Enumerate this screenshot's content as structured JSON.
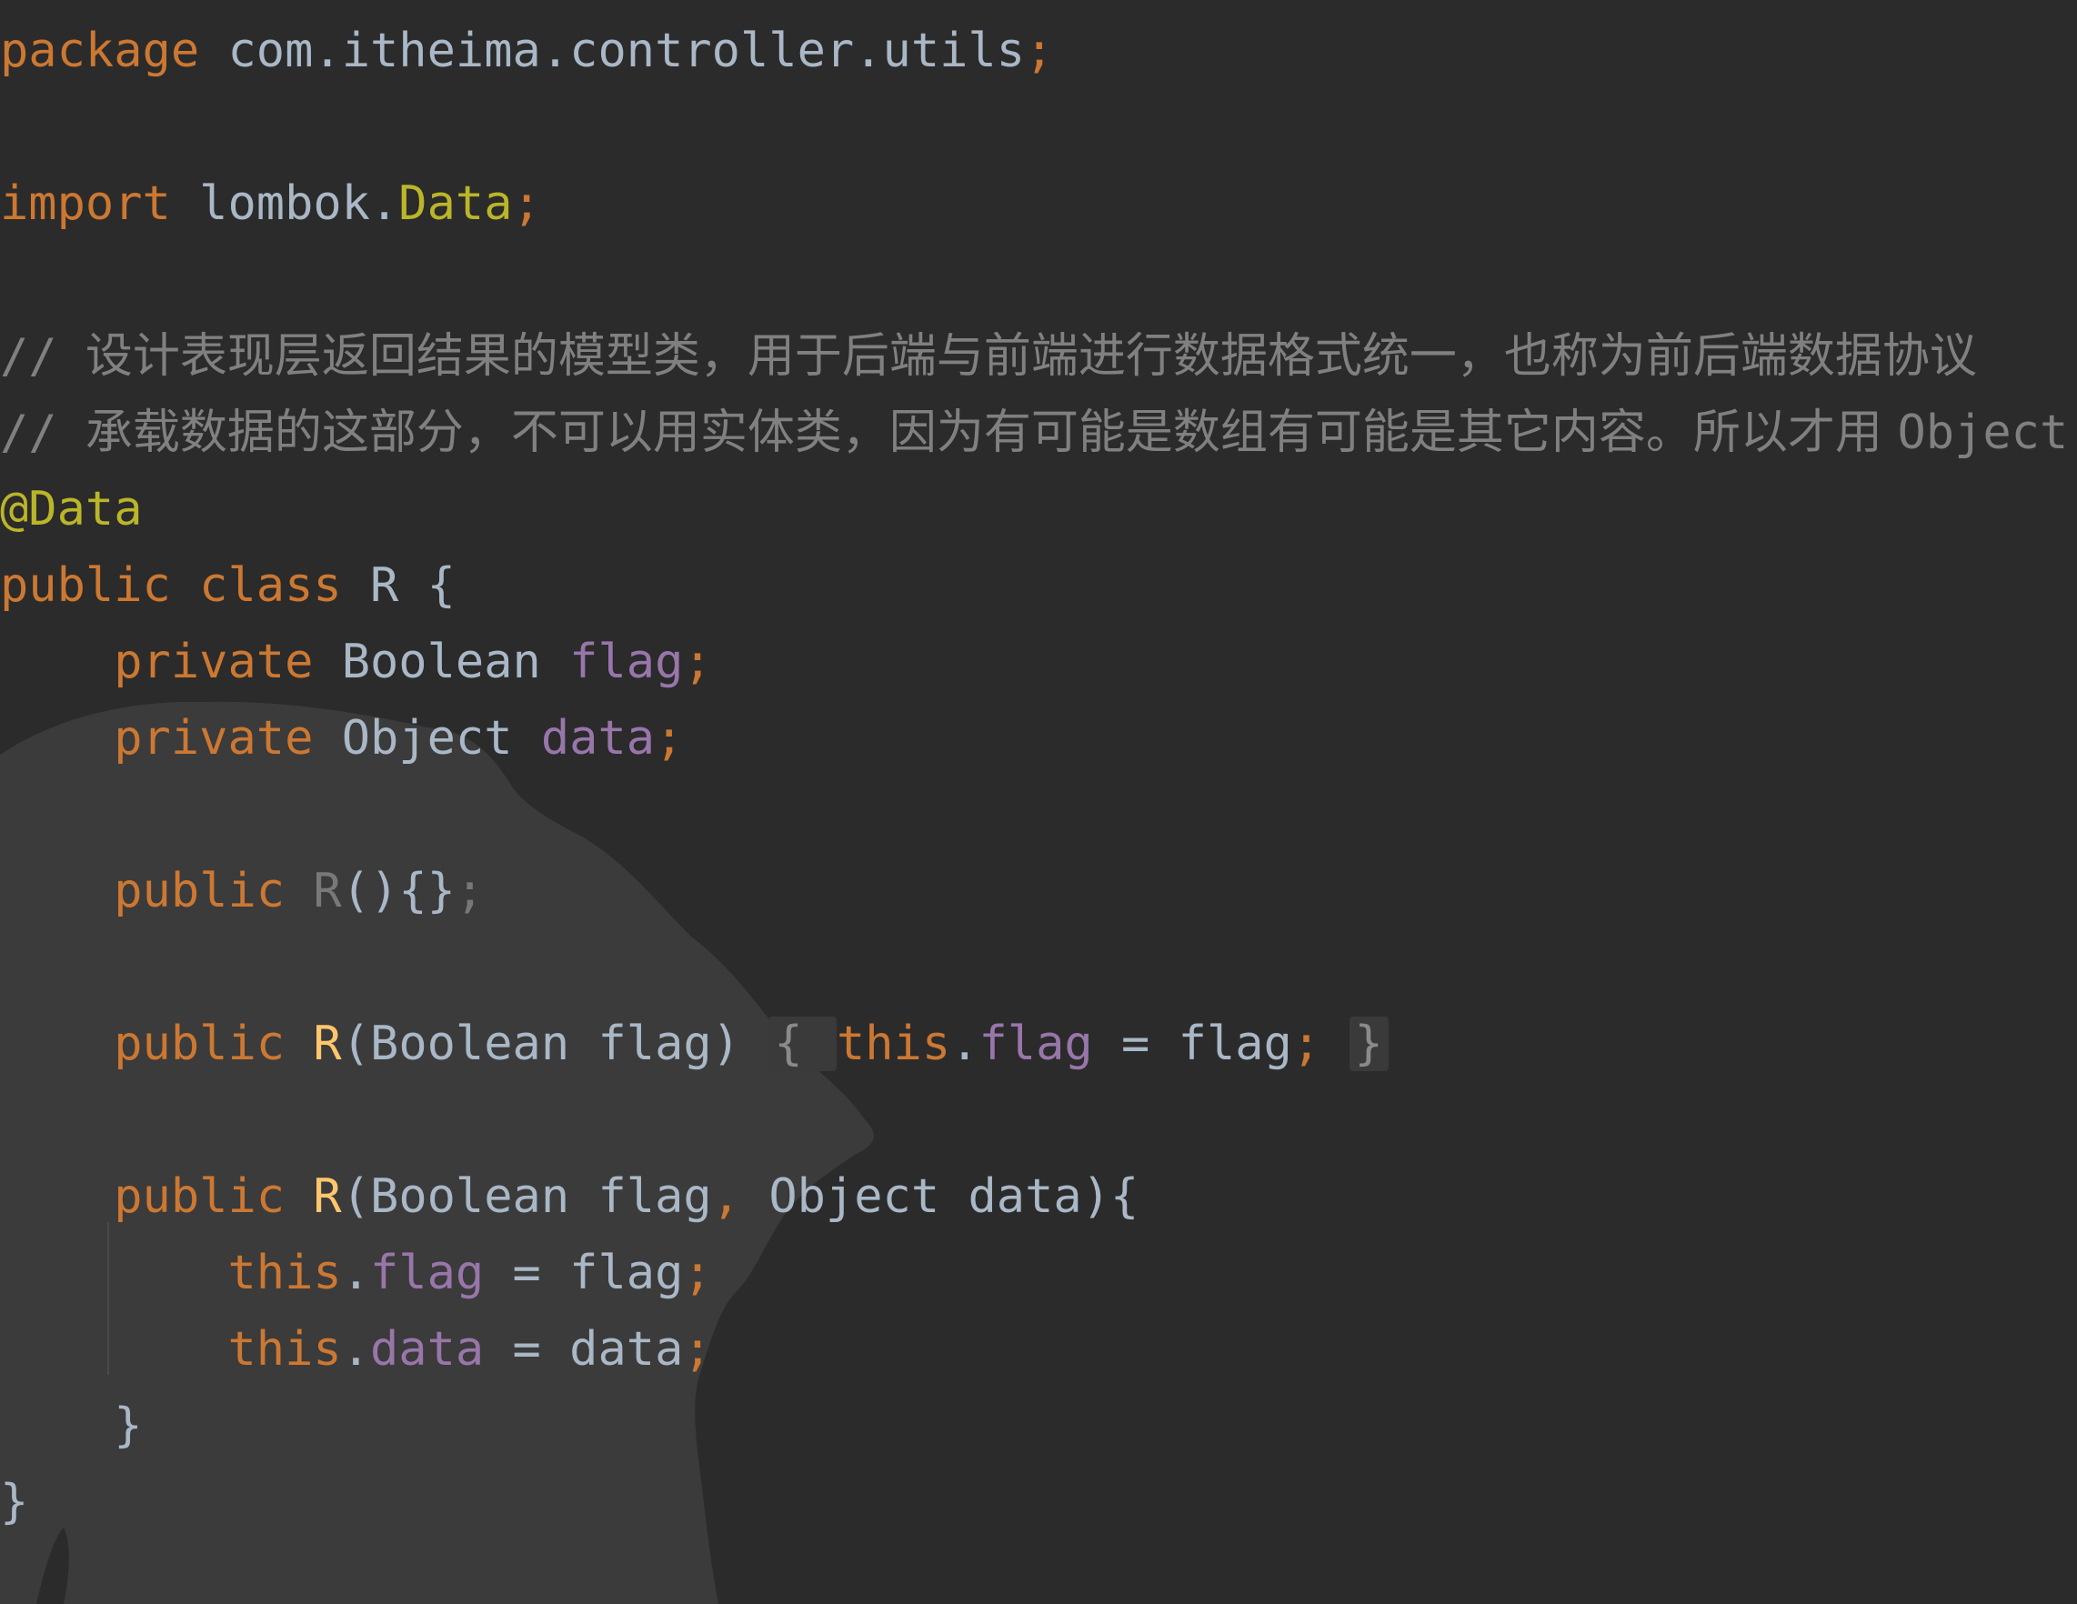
{
  "editor": {
    "background": "#2b2b2b",
    "lines": [
      {
        "tokens": [
          {
            "t": "package",
            "c": "tok-keyword"
          },
          {
            "t": " com.itheima.controller.utils",
            "c": "tok-default"
          },
          {
            "t": ";",
            "c": "tok-punct"
          }
        ]
      },
      {
        "tokens": []
      },
      {
        "tokens": [
          {
            "t": "import",
            "c": "tok-keyword"
          },
          {
            "t": " lombok.",
            "c": "tok-default"
          },
          {
            "t": "Data",
            "c": "tok-type"
          },
          {
            "t": ";",
            "c": "tok-punct"
          }
        ]
      },
      {
        "tokens": []
      },
      {
        "tokens": [
          {
            "t": "// ",
            "c": "tok-comment"
          },
          {
            "t": "设计表现层返回结果的模型类，用于后端与前端进行数据格式统一，也称为前后端数据协议",
            "c": "tok-comment tok-comment-cjk"
          }
        ]
      },
      {
        "tokens": [
          {
            "t": "// ",
            "c": "tok-comment"
          },
          {
            "t": "承载数据的这部分，不可以用实体类，因为有可能是数组有可能是其它内容。所以才用 ",
            "c": "tok-comment tok-comment-cjk"
          },
          {
            "t": "Object",
            "c": "tok-comment"
          }
        ]
      },
      {
        "tokens": [
          {
            "t": "@Data",
            "c": "tok-anno"
          }
        ]
      },
      {
        "tokens": [
          {
            "t": "public class",
            "c": "tok-keyword"
          },
          {
            "t": " R {",
            "c": "tok-default"
          }
        ]
      },
      {
        "tokens": [
          {
            "t": "    ",
            "c": "tok-default"
          },
          {
            "t": "private",
            "c": "tok-keyword"
          },
          {
            "t": " Boolean ",
            "c": "tok-default"
          },
          {
            "t": "flag",
            "c": "tok-field"
          },
          {
            "t": ";",
            "c": "tok-punct"
          }
        ]
      },
      {
        "tokens": [
          {
            "t": "    ",
            "c": "tok-default"
          },
          {
            "t": "private",
            "c": "tok-keyword"
          },
          {
            "t": " Object ",
            "c": "tok-default"
          },
          {
            "t": "data",
            "c": "tok-field"
          },
          {
            "t": ";",
            "c": "tok-punct"
          }
        ]
      },
      {
        "tokens": []
      },
      {
        "tokens": [
          {
            "t": "    ",
            "c": "tok-default"
          },
          {
            "t": "public",
            "c": "tok-keyword"
          },
          {
            "t": " ",
            "c": "tok-default"
          },
          {
            "t": "R",
            "c": "tok-gray"
          },
          {
            "t": "(){}",
            "c": "tok-default"
          },
          {
            "t": ";",
            "c": "tok-gray"
          }
        ]
      },
      {
        "tokens": []
      },
      {
        "tokens": [
          {
            "t": "    ",
            "c": "tok-default"
          },
          {
            "t": "public",
            "c": "tok-keyword"
          },
          {
            "t": " ",
            "c": "tok-default"
          },
          {
            "t": "R",
            "c": "tok-ctor"
          },
          {
            "t": "(Boolean flag) ",
            "c": "tok-default"
          },
          {
            "t": "{ ",
            "c": "fold-box"
          },
          {
            "t": "this",
            "c": "tok-keyword"
          },
          {
            "t": ".",
            "c": "tok-default"
          },
          {
            "t": "flag",
            "c": "tok-field"
          },
          {
            "t": " = flag",
            "c": "tok-default"
          },
          {
            "t": ";",
            "c": "tok-punct"
          },
          {
            "t": " ",
            "c": "tok-default"
          },
          {
            "t": "}",
            "c": "fold-box"
          }
        ]
      },
      {
        "tokens": []
      },
      {
        "tokens": [
          {
            "t": "    ",
            "c": "tok-default"
          },
          {
            "t": "public",
            "c": "tok-keyword"
          },
          {
            "t": " ",
            "c": "tok-default"
          },
          {
            "t": "R",
            "c": "tok-ctor"
          },
          {
            "t": "(Boolean flag",
            "c": "tok-default"
          },
          {
            "t": ",",
            "c": "tok-punct"
          },
          {
            "t": " Object data){",
            "c": "tok-default"
          }
        ]
      },
      {
        "tokens": [
          {
            "t": "        ",
            "c": "tok-default"
          },
          {
            "t": "this",
            "c": "tok-keyword"
          },
          {
            "t": ".",
            "c": "tok-default"
          },
          {
            "t": "flag",
            "c": "tok-field"
          },
          {
            "t": " = flag",
            "c": "tok-default"
          },
          {
            "t": ";",
            "c": "tok-punct"
          }
        ]
      },
      {
        "tokens": [
          {
            "t": "        ",
            "c": "tok-default"
          },
          {
            "t": "this",
            "c": "tok-keyword"
          },
          {
            "t": ".",
            "c": "tok-default"
          },
          {
            "t": "data",
            "c": "tok-field"
          },
          {
            "t": " = data",
            "c": "tok-default"
          },
          {
            "t": ";",
            "c": "tok-punct"
          }
        ]
      },
      {
        "tokens": [
          {
            "t": "    }",
            "c": "tok-default"
          }
        ]
      },
      {
        "tokens": [
          {
            "t": "}",
            "c": "tok-default"
          }
        ]
      }
    ]
  }
}
